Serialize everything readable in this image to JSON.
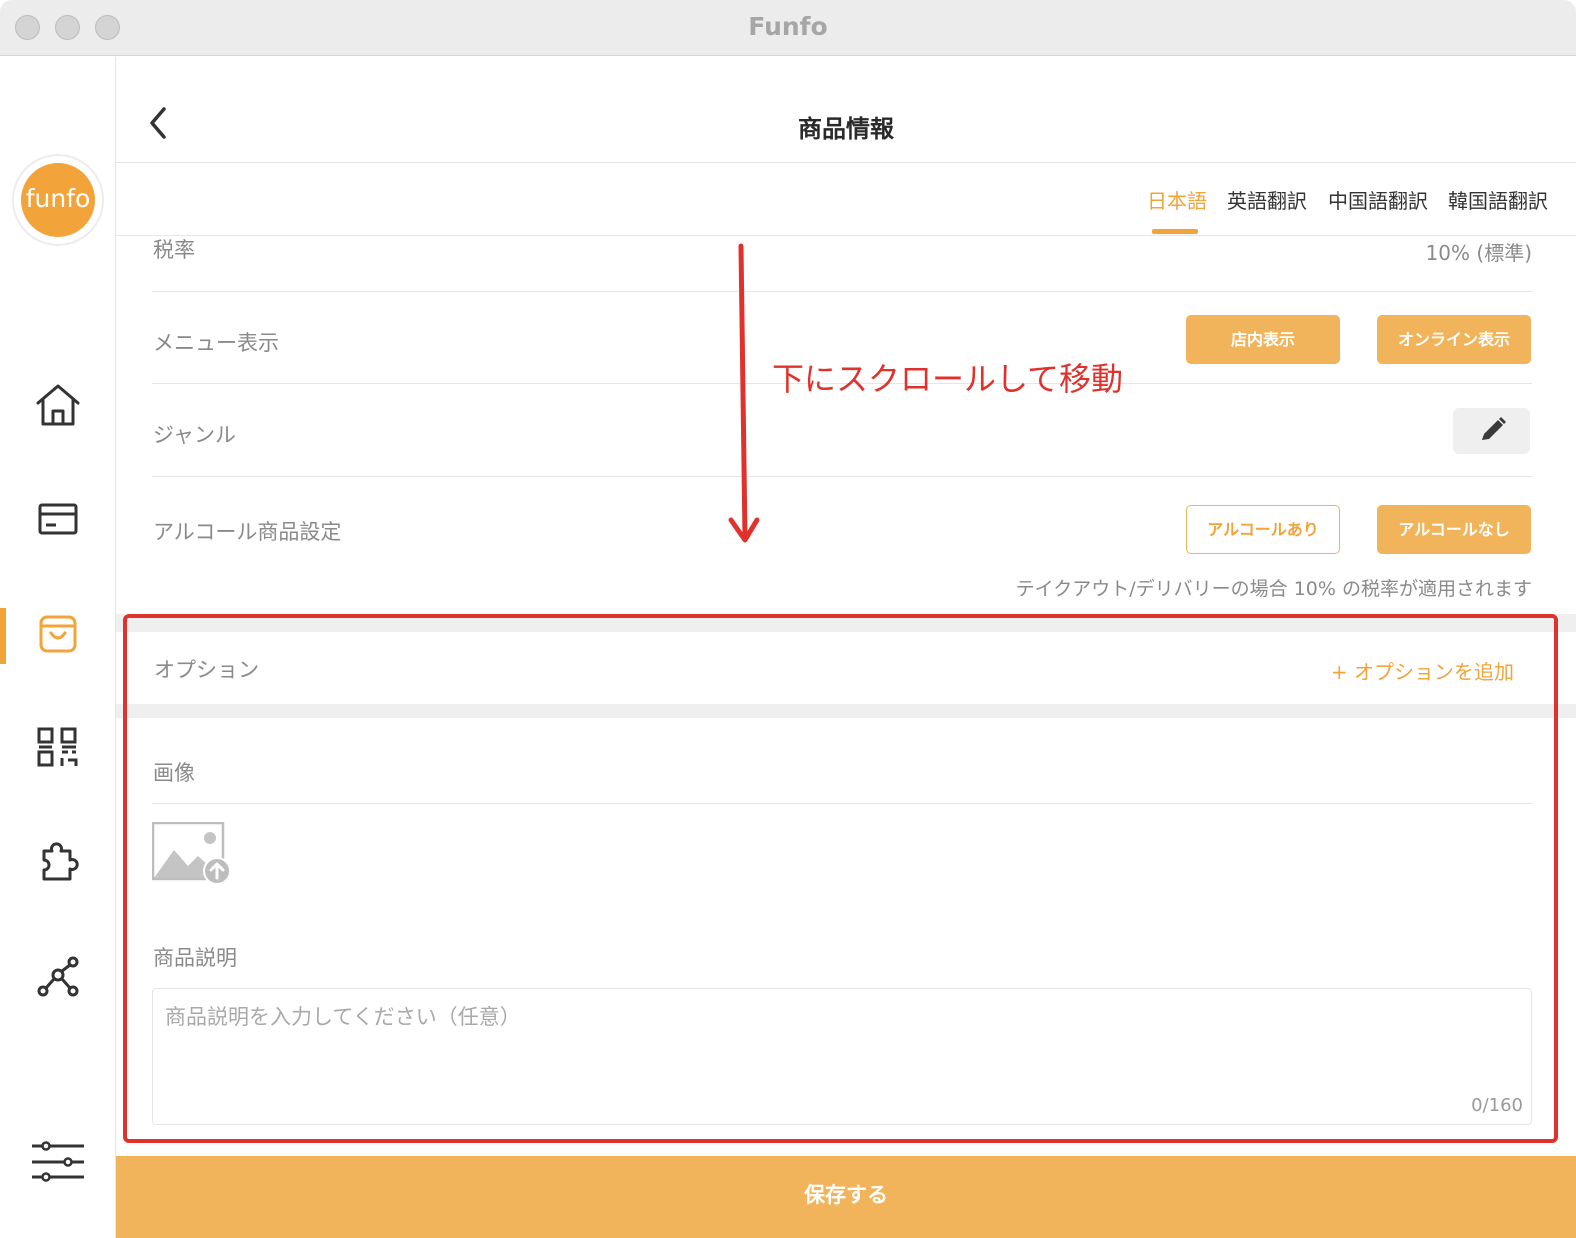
{
  "window": {
    "title": "Funfo"
  },
  "sidebar": {
    "logo_text": "funfo",
    "items": [
      {
        "name": "home",
        "icon": "home-icon"
      },
      {
        "name": "payments",
        "icon": "card-icon"
      },
      {
        "name": "products",
        "icon": "shopping-bag-icon",
        "active": true
      },
      {
        "name": "qr",
        "icon": "qr-code-icon"
      },
      {
        "name": "extensions",
        "icon": "puzzle-icon"
      },
      {
        "name": "connections",
        "icon": "share-network-icon"
      },
      {
        "name": "settings",
        "icon": "sliders-icon"
      }
    ]
  },
  "header": {
    "title": "商品情報",
    "back_icon": "chevron-left-icon"
  },
  "tabs": [
    {
      "label": "日本語",
      "active": true
    },
    {
      "label": "英語翻訳"
    },
    {
      "label": "中国語翻訳"
    },
    {
      "label": "韓国語翻訳"
    }
  ],
  "form": {
    "tax": {
      "label": "税率",
      "value": "10% (標準)"
    },
    "menu_display": {
      "label": "メニュー表示",
      "store_button": "店内表示",
      "online_button": "オンライン表示"
    },
    "genre": {
      "label": "ジャンル",
      "edit_icon": "pencil-icon"
    },
    "alcohol": {
      "label": "アルコール商品設定",
      "yes_button": "アルコールあり",
      "no_button": "アルコールなし",
      "note": "テイクアウト/デリバリーの場合 10% の税率が適用されます"
    },
    "option": {
      "label": "オプション",
      "add_label": "+ オプションを追加"
    },
    "image": {
      "label": "画像",
      "upload_icon": "image-upload-icon"
    },
    "description": {
      "label": "商品説明",
      "placeholder": "商品説明を入力してください（任意）",
      "counter": "0/160"
    }
  },
  "save_button": "保存する",
  "annotation": {
    "text": "下にスクロールして移動"
  },
  "colors": {
    "accent": "#f2a33a",
    "button_fill": "#f2b45a",
    "annotation": "#e0322d"
  }
}
